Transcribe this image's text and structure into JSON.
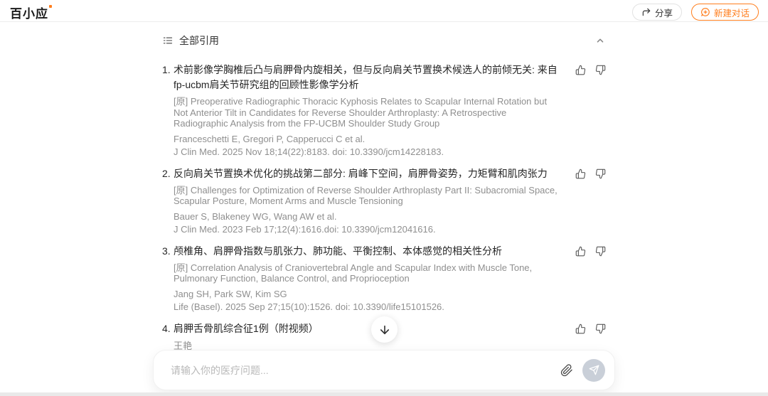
{
  "app": {
    "logo": "百小应"
  },
  "header": {
    "share_button": "分享",
    "new_chat_button": "新建对话"
  },
  "citations": {
    "panel_title": "全部引用",
    "items": [
      {
        "num": "1.",
        "title_zh": "术前影像学胸椎后凸与肩胛骨内旋相关，但与反向肩关节置换术候选人的前倾无关: 来自fp-ucbm肩关节研究组的回顾性影像学分析",
        "title_en": "[原] Preoperative Radiographic Thoracic Kyphosis Relates to Scapular Internal Rotation but Not Anterior Tilt in Candidates for Reverse Shoulder Arthroplasty: A Retrospective Radiographic Analysis from the FP-UCBM Shoulder Study Group",
        "authors": "Franceschetti E, Gregori P, Capperucci C et al.",
        "journal": "J Clin Med. 2025 Nov 18;14(22):8183. doi: 10.3390/jcm14228183."
      },
      {
        "num": "2.",
        "title_zh": "反向肩关节置换术优化的挑战第二部分: 肩峰下空间，肩胛骨姿势，力矩臂和肌肉张力",
        "title_en": "[原] Challenges for Optimization of Reverse Shoulder Arthroplasty Part II: Subacromial Space, Scapular Posture, Moment Arms and Muscle Tensioning",
        "authors": "Bauer S, Blakeney WG, Wang AW et al.",
        "journal": "J Clin Med. 2023 Feb 17;12(4):1616.doi: 10.3390/jcm12041616."
      },
      {
        "num": "3.",
        "title_zh": "颅椎角、肩胛骨指数与肌张力、肺功能、平衡控制、本体感觉的相关性分析",
        "title_en": "[原] Correlation Analysis of Craniovertebral Angle and Scapular Index with Muscle Tone, Pulmonary Function, Balance Control, and Proprioception",
        "authors": "Jang SH, Park SW, Kim SG",
        "journal": "Life (Basel). 2025 Sep 27;15(10):1526. doi: 10.3390/life15101526."
      },
      {
        "num": "4.",
        "title_zh": "肩胛舌骨肌综合征1例（附视频）",
        "authors": "王艳"
      }
    ]
  },
  "composer": {
    "placeholder": "请输入你的医疗问题..."
  },
  "icons": {
    "list": "list-lines",
    "collapse": "chevron-up",
    "like": "thumbs-up-outline",
    "dislike": "thumbs-down-outline",
    "share": "corner-up-right-arrow",
    "new_chat": "chat-bubble-plus",
    "attach": "paperclip",
    "send": "paper-plane",
    "scroll_down": "arrow-down"
  },
  "colors": {
    "accent_orange": "#FF7E1D",
    "title_text": "#262626",
    "meta_text": "#8F8F8F",
    "send_button_bg": "#C9CFD8"
  }
}
